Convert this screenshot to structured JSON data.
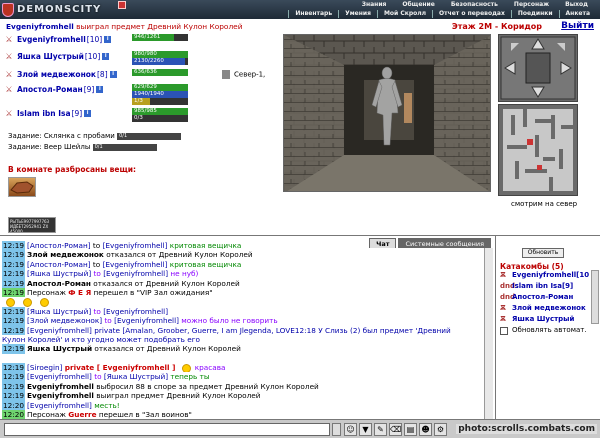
{
  "header": {
    "logo": "DEMONSCITY",
    "menu_top": [
      "Знания",
      "Общение",
      "Безопасность",
      "Персонаж",
      "Выход"
    ],
    "menu_bottom": [
      "Инвентарь",
      "Умения",
      "Мой Скролл",
      "Отчет о переводах",
      "Поединки",
      "Анкета"
    ]
  },
  "left": {
    "winner_name": "Evgeniyfromhell",
    "winner_text": "выиграл предмет Древний Кулон Королей",
    "players": [
      {
        "name": "Evgeniyfromhell",
        "level": "[10]",
        "hp": "946/1261",
        "hp_frac": 0.75,
        "mp": "",
        "mp_frac": 0
      },
      {
        "name": "Яшка Шустрый",
        "level": "[10]",
        "hp": "980/980",
        "hp_frac": 1.0,
        "mp": "2130/2260",
        "mp_frac": 0.94
      },
      {
        "name": "Злой медвежонок",
        "level": "[8]",
        "hp": "636/636",
        "hp_frac": 1.0,
        "mp": "",
        "mp_frac": 0
      },
      {
        "name": "Апостол-Роман",
        "level": "[9]",
        "hp": "629/629",
        "hp_frac": 1.0,
        "mp": "1940/1940",
        "mp_frac": 1.0,
        "extra": "1/3"
      },
      {
        "name": "Islam ibn Isa",
        "level": "[9]",
        "hp": "985/985",
        "hp_frac": 1.0,
        "mp": "0/3",
        "mp_frac": 0
      }
    ],
    "location": "Север-1,",
    "tasks": [
      {
        "label": "Задание: Склянка с пробами",
        "value": "0/1"
      },
      {
        "label": "Задание:          Веер Шейлы",
        "value": "0/1"
      }
    ],
    "scattered_title": "В комнате разбросаны вещи:",
    "item_code": "РЫТЬЕ9977997763 ИДЁЕТ2952941 ZX 45000"
  },
  "game": {
    "floor": "Этаж 2М - Коридор",
    "exit": "Выйти",
    "look": "смотрим на север"
  },
  "chat": {
    "tabs": [
      "Чат",
      "Системные сообщения"
    ],
    "lines": [
      {
        "time": "12:19",
        "parts": [
          [
            "bl",
            "[Апостол-Роман]"
          ],
          [
            "",
            "to"
          ],
          [
            "bl",
            "[Evgeniyfromhell]"
          ],
          [
            "gr",
            "критовая вещичка"
          ]
        ]
      },
      {
        "time": "12:19",
        "parts": [
          [
            "b",
            "Злой медвежонок"
          ],
          [
            "",
            "отказался от Древний Кулон Королей"
          ]
        ]
      },
      {
        "time": "12:19",
        "parts": [
          [
            "bl",
            "[Апостол-Роман]"
          ],
          [
            "",
            "to"
          ],
          [
            "bl",
            "[Evgeniyfromhell]"
          ],
          [
            "gr",
            "критовая вещичка"
          ]
        ]
      },
      {
        "time": "12:19",
        "parts": [
          [
            "bl",
            "[Яшка Шустрый]"
          ],
          [
            "pu",
            "to"
          ],
          [
            "bl",
            "[Evgeniyfromhell]"
          ],
          [
            "pu",
            "не нуб)"
          ]
        ]
      },
      {
        "time": "12:19",
        "parts": [
          [
            "b",
            "Апостол-Роман"
          ],
          [
            "",
            "отказался от Древний Кулон Королей"
          ]
        ]
      },
      {
        "time": "12:19",
        "green": true,
        "parts": [
          [
            "",
            "Персонаж"
          ],
          [
            "rd",
            "Ф Е Я"
          ],
          [
            "",
            "перешел в \"VIP Зал ожидания\""
          ]
        ]
      },
      {
        "time": "",
        "parts": [
          [
            "sm",
            ""
          ],
          [
            "sm",
            ""
          ],
          [
            "sm",
            ""
          ]
        ]
      },
      {
        "time": "12:19",
        "parts": [
          [
            "bl",
            "[Яшка Шустрый]"
          ],
          [
            "pu",
            "to"
          ],
          [
            "bl",
            "[Evgeniyfromhell]"
          ]
        ]
      },
      {
        "time": "12:19",
        "parts": [
          [
            "bl",
            "[Злой медвежонок]"
          ],
          [
            "pu",
            "to"
          ],
          [
            "bl",
            "[Evgeniyfromhell]"
          ],
          [
            "pu",
            "можно было не говорить"
          ]
        ]
      },
      {
        "time": "12:19",
        "parts": [
          [
            "bl",
            "[Evgeniyfromhell]"
          ],
          [
            "bl",
            "private [Amalan, Groober, Guerre, I am Jlegenda, LOVE12:18 У Слизь (2) был предмет 'Древний"
          ]
        ]
      },
      {
        "time": "",
        "parts": [
          [
            "bl",
            "Кулон Королей' и кто угодно может подобрать его"
          ]
        ]
      },
      {
        "time": "12:19",
        "parts": [
          [
            "b",
            "Яшка Шустрый"
          ],
          [
            "",
            "отказался от Древний Кулон Королей"
          ]
        ]
      },
      {
        "time": "",
        "parts": []
      },
      {
        "time": "12:19",
        "parts": [
          [
            "bl",
            "[Siroegin]"
          ],
          [
            "rd",
            "private [ Evgeniyfromhell ]"
          ],
          [
            "sm",
            ""
          ],
          [
            "pu",
            "красава"
          ]
        ]
      },
      {
        "time": "12:19",
        "parts": [
          [
            "bl",
            "[Evgeniyfromhell]"
          ],
          [
            "pu",
            "to"
          ],
          [
            "bl",
            "[Яшка Шустрый]"
          ],
          [
            "gr",
            "теперь ты"
          ]
        ]
      },
      {
        "time": "12:19",
        "parts": [
          [
            "b",
            "Evgeniyfromhell"
          ],
          [
            "",
            "выбросил 88 в споре за предмет Древний Кулон Королей"
          ]
        ]
      },
      {
        "time": "12:19",
        "parts": [
          [
            "b",
            "Evgeniyfromhell"
          ],
          [
            "",
            "выиграл предмет Древний Кулон Королей"
          ]
        ]
      },
      {
        "time": "12:20",
        "parts": [
          [
            "bl",
            "[Evgeniyfromhell]"
          ],
          [
            "gr",
            "месть!"
          ]
        ]
      },
      {
        "time": "12:20",
        "green": true,
        "parts": [
          [
            "",
            "Персонаж"
          ],
          [
            "rd",
            "Guerre"
          ],
          [
            "",
            "перешел в \"Зал воинов\""
          ]
        ]
      }
    ]
  },
  "right": {
    "refresh": "Обновить",
    "title": "Катакомбы (5)",
    "users": [
      {
        "icon": "Ѫ",
        "name": "Evgeniyfromhell[10"
      },
      {
        "icon": "dnd",
        "name": "Islam ibn Isa[9]"
      },
      {
        "icon": "dnd",
        "name": "Апостол-Роман"
      },
      {
        "icon": "Ѫ",
        "name": "Злой медвежонок"
      },
      {
        "icon": "Ѫ",
        "name": "Яшка Шустрый"
      }
    ],
    "auto_label": "Обновлять автомат."
  },
  "footer": {
    "watermark": "photo:scrolls.combats.com"
  }
}
